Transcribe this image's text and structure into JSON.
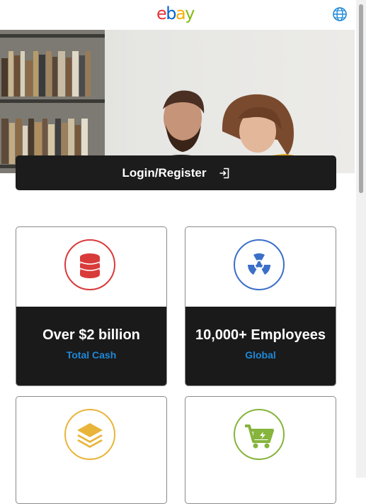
{
  "header": {
    "logo": {
      "e": "e",
      "b": "b",
      "a": "a",
      "y": "y"
    },
    "language_icon": "globe-icon"
  },
  "hero": {
    "login_label": "Login/Register",
    "login_icon": "sign-in-icon"
  },
  "stats": [
    {
      "value": "Over $2 billion",
      "label": "Total Cash",
      "icon": "coins-icon",
      "color": "#d93a3a"
    },
    {
      "value": "10,000+ Employees",
      "label": "Global",
      "icon": "radiation-icon",
      "color": "#3b6fc9"
    },
    {
      "value": "",
      "label": "",
      "icon": "layers-icon",
      "color": "#e8b53a"
    },
    {
      "value": "",
      "label": "",
      "icon": "cart-icon",
      "color": "#86b43c"
    }
  ],
  "colors": {
    "label_blue": "#1e88d9",
    "card_dark": "#1a1a1a"
  }
}
